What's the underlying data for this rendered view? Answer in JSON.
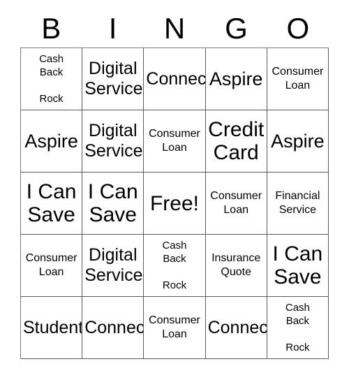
{
  "card": {
    "header_letters": [
      "B",
      "I",
      "N",
      "G",
      "O"
    ],
    "free_space_label": "Free!",
    "grid": {
      "columns": 5,
      "rows": 5,
      "cells": [
        [
          {
            "text": "Cash\nBack\n\nRock",
            "size": "xs"
          },
          {
            "text": "Digital\nService",
            "size": "md"
          },
          {
            "text": "Connect",
            "size": "md"
          },
          {
            "text": "Aspire",
            "size": "lg"
          },
          {
            "text": "Consumer\nLoan",
            "size": "sm"
          }
        ],
        [
          {
            "text": "Aspire",
            "size": "lg"
          },
          {
            "text": "Digital\nService",
            "size": "md"
          },
          {
            "text": "Consumer\nLoan",
            "size": "sm"
          },
          {
            "text": "Credit\nCard",
            "size": "xl"
          },
          {
            "text": "Aspire",
            "size": "lg"
          }
        ],
        [
          {
            "text": "I Can\nSave",
            "size": "xl"
          },
          {
            "text": "I Can\nSave",
            "size": "xl"
          },
          {
            "text": "Free!",
            "size": "xl"
          },
          {
            "text": "Consumer\nLoan",
            "size": "sm"
          },
          {
            "text": "Financial\nService",
            "size": "sm"
          }
        ],
        [
          {
            "text": "Consumer\nLoan",
            "size": "sm"
          },
          {
            "text": "Digital\nService",
            "size": "md"
          },
          {
            "text": "Cash\nBack\n\nRock",
            "size": "xs"
          },
          {
            "text": "Insurance\nQuote",
            "size": "sm"
          },
          {
            "text": "I Can\nSave",
            "size": "xl"
          }
        ],
        [
          {
            "text": "Student",
            "size": "md"
          },
          {
            "text": "Connect",
            "size": "md"
          },
          {
            "text": "Consumer\nLoan",
            "size": "sm"
          },
          {
            "text": "Connect",
            "size": "md"
          },
          {
            "text": "Cash\nBack\n\nRock",
            "size": "xs"
          }
        ]
      ]
    },
    "colors": {
      "background": "#ffffff",
      "text": "#000000",
      "grid_line": "#5a5a5a"
    }
  }
}
